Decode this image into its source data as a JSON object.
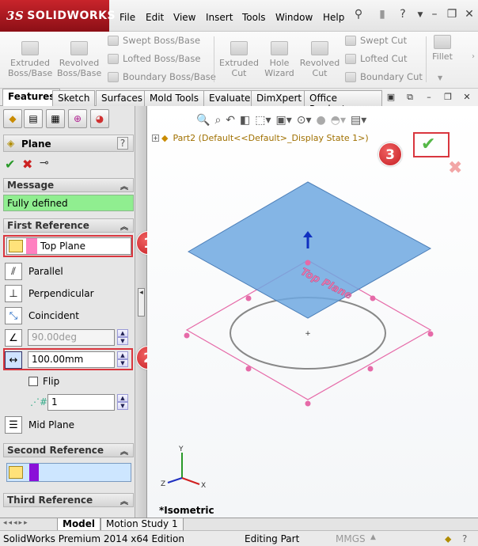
{
  "app": {
    "brand": "SOLIDWORKS",
    "brand_prefix": "3S"
  },
  "menu": {
    "items": [
      "File",
      "Edit",
      "View",
      "Insert",
      "Tools",
      "Window",
      "Help"
    ]
  },
  "ribbon": {
    "extruded_boss": "Extruded\nBoss/Base",
    "revolved_boss": "Revolved\nBoss/Base",
    "swept_boss": "Swept Boss/Base",
    "lofted_boss": "Lofted Boss/Base",
    "boundary_boss": "Boundary Boss/Base",
    "extruded_cut": "Extruded\nCut",
    "hole_wizard": "Hole\nWizard",
    "revolved_cut": "Revolved\nCut",
    "swept_cut": "Swept Cut",
    "lofted_cut": "Lofted Cut",
    "boundary_cut": "Boundary Cut",
    "fillet": "Fillet"
  },
  "tabs": [
    "Features",
    "Sketch",
    "Surfaces",
    "Mold Tools",
    "Evaluate",
    "DimXpert",
    "Office Products"
  ],
  "property_manager": {
    "title": "Plane",
    "help": "?",
    "message_header": "Message",
    "message": "Fully defined",
    "first_reference_header": "First Reference",
    "first_reference_value": "Top Plane",
    "parallel": "Parallel",
    "perpendicular": "Perpendicular",
    "coincident": "Coincident",
    "angle_value": "90.00deg",
    "distance_value": "100.00mm",
    "flip": "Flip",
    "count_value": "1",
    "mid_plane": "Mid Plane",
    "second_reference_header": "Second Reference",
    "third_reference_header": "Third Reference"
  },
  "tree": {
    "item": "Part2  (Default<<Default>_Display State 1>)"
  },
  "viewport": {
    "plane_label": "Top Plane",
    "view_name": "*Isometric",
    "axis_x": "X",
    "axis_y": "Y",
    "axis_z": "Z"
  },
  "annotations": {
    "b1": "1",
    "b2": "2",
    "b3": "3"
  },
  "bottom_tabs": [
    "Model",
    "Motion Study 1"
  ],
  "status": {
    "edition": "SolidWorks Premium 2014 x64 Edition",
    "mode": "Editing Part",
    "units": "MMGS"
  },
  "colors": {
    "accent_red": "#d9363e",
    "message_bg": "#90ee90",
    "plane_blue": "#6fa8e0",
    "ok_green": "#56b848"
  }
}
